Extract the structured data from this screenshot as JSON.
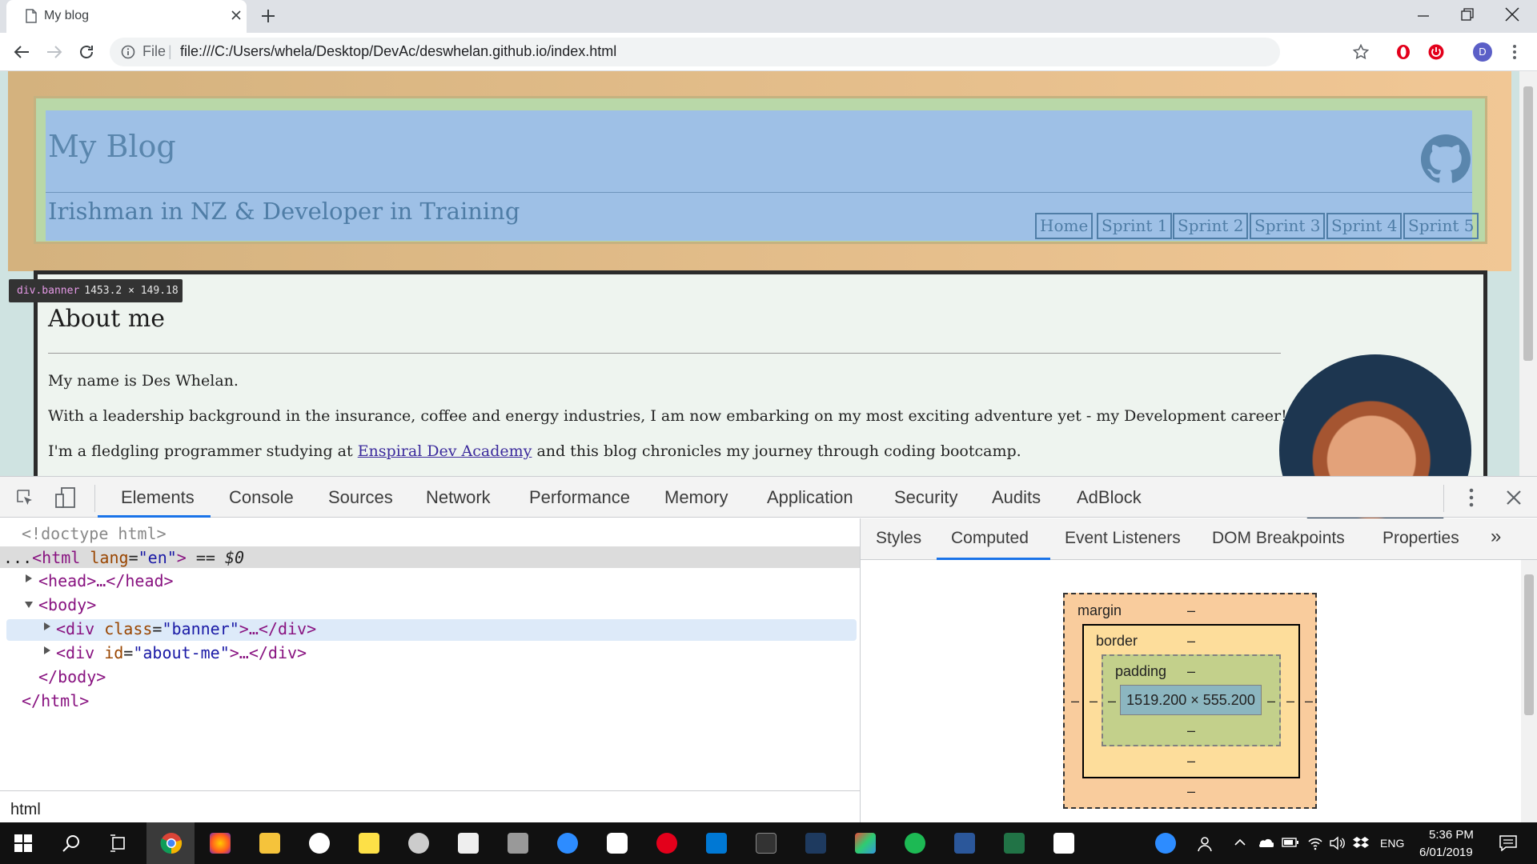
{
  "browser": {
    "tab_title": "My blog",
    "omnibox_scheme": "File",
    "omnibox_separator": "|",
    "url": "file:///C:/Users/whela/Desktop/DevAc/deswhelan.github.io/index.html",
    "profile_initial": "D"
  },
  "page": {
    "blog_title": "My Blog",
    "tagline": "Irishman in NZ & Developer in Training",
    "nav": [
      "Home",
      "Sprint 1",
      "Sprint 2",
      "Sprint 3",
      "Sprint 4",
      "Sprint 5"
    ],
    "tooltip_tag": "div.banner",
    "tooltip_dims": "1453.2 × 149.18",
    "about_title": "About me",
    "p1": "My name is Des Whelan.",
    "p2": "With a leadership background in the insurance, coffee and energy industries, I am now embarking on my most exciting adventure yet - my Development career!",
    "p3_before": "I'm a fledgling programmer studying at ",
    "p3_link": "Enspiral Dev Academy",
    "p3_after": " and this blog chronicles my journey through coding bootcamp."
  },
  "devtools": {
    "tabs": [
      "Elements",
      "Console",
      "Sources",
      "Network",
      "Performance",
      "Memory",
      "Application",
      "Security",
      "Audits",
      "AdBlock"
    ],
    "active_tab": "Elements",
    "dom": {
      "doctype": "<!doctype html>",
      "html_dots": "...",
      "html_open": "<html",
      "html_attr": " lang",
      "html_eq": "=",
      "html_val": "\"en\"",
      "html_close": ">",
      "html_sel": " == $0",
      "head": "<head>…</head>",
      "body_open": "<body>",
      "div_banner_open": "<div",
      "div_banner_attr": " class",
      "div_banner_val": "\"banner\"",
      "div_banner_rest": ">…</div>",
      "div_about_open": "<div",
      "div_about_attr": " id",
      "div_about_val": "\"about-me\"",
      "div_about_rest": ">…</div>",
      "body_close": "</body>",
      "html_end": "</html>"
    },
    "breadcrumb": "html",
    "side_tabs": [
      "Styles",
      "Computed",
      "Event Listeners",
      "DOM Breakpoints",
      "Properties"
    ],
    "side_more": "»",
    "active_side_tab": "Computed",
    "box_model": {
      "margin_label": "margin",
      "border_label": "border",
      "padding_label": "padding",
      "dash": "–",
      "content": "1519.200 × 555.200"
    }
  },
  "taskbar": {
    "language": "ENG",
    "time": "5:36 PM",
    "date": "6/01/2019"
  }
}
